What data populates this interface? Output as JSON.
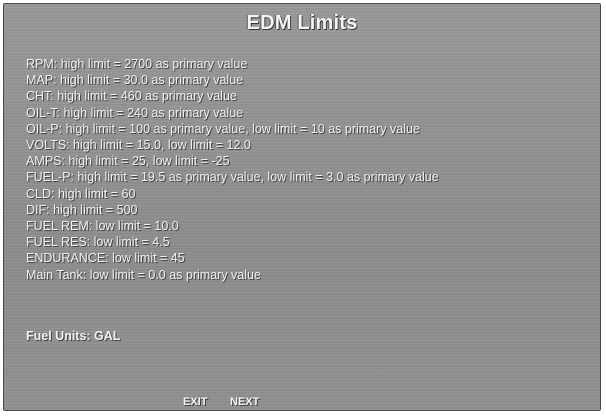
{
  "screen": {
    "title": "EDM Limits"
  },
  "limits": [
    "RPM:  high limit = 2700 as primary value",
    "MAP:  high limit = 30.0 as primary value",
    "CHT:  high limit = 460 as primary value",
    "OIL-T:  high limit = 240 as primary value",
    "OIL-P:  high limit = 100 as primary value, low limit = 10 as primary value",
    "VOLTS:  high limit = 15.0, low limit = 12.0",
    "AMPS:  high limit = 25, low limit = -25",
    "FUEL-P:  high limit = 19.5 as primary value, low limit = 3.0 as primary value",
    "CLD:  high limit = 60",
    "DIF:  high limit = 500",
    "FUEL REM:  low limit = 10.0",
    "FUEL RES:  low limit = 4.5",
    "ENDURANCE:  low limit = 45",
    "Main Tank:  low limit = 0.0 as primary value"
  ],
  "fuel_units": "Fuel Units: GAL",
  "softkeys": {
    "exit": "EXIT",
    "next": "NEXT"
  },
  "colors": {
    "screen_background": "#8e8e8e",
    "text": "#f2f2f2"
  }
}
